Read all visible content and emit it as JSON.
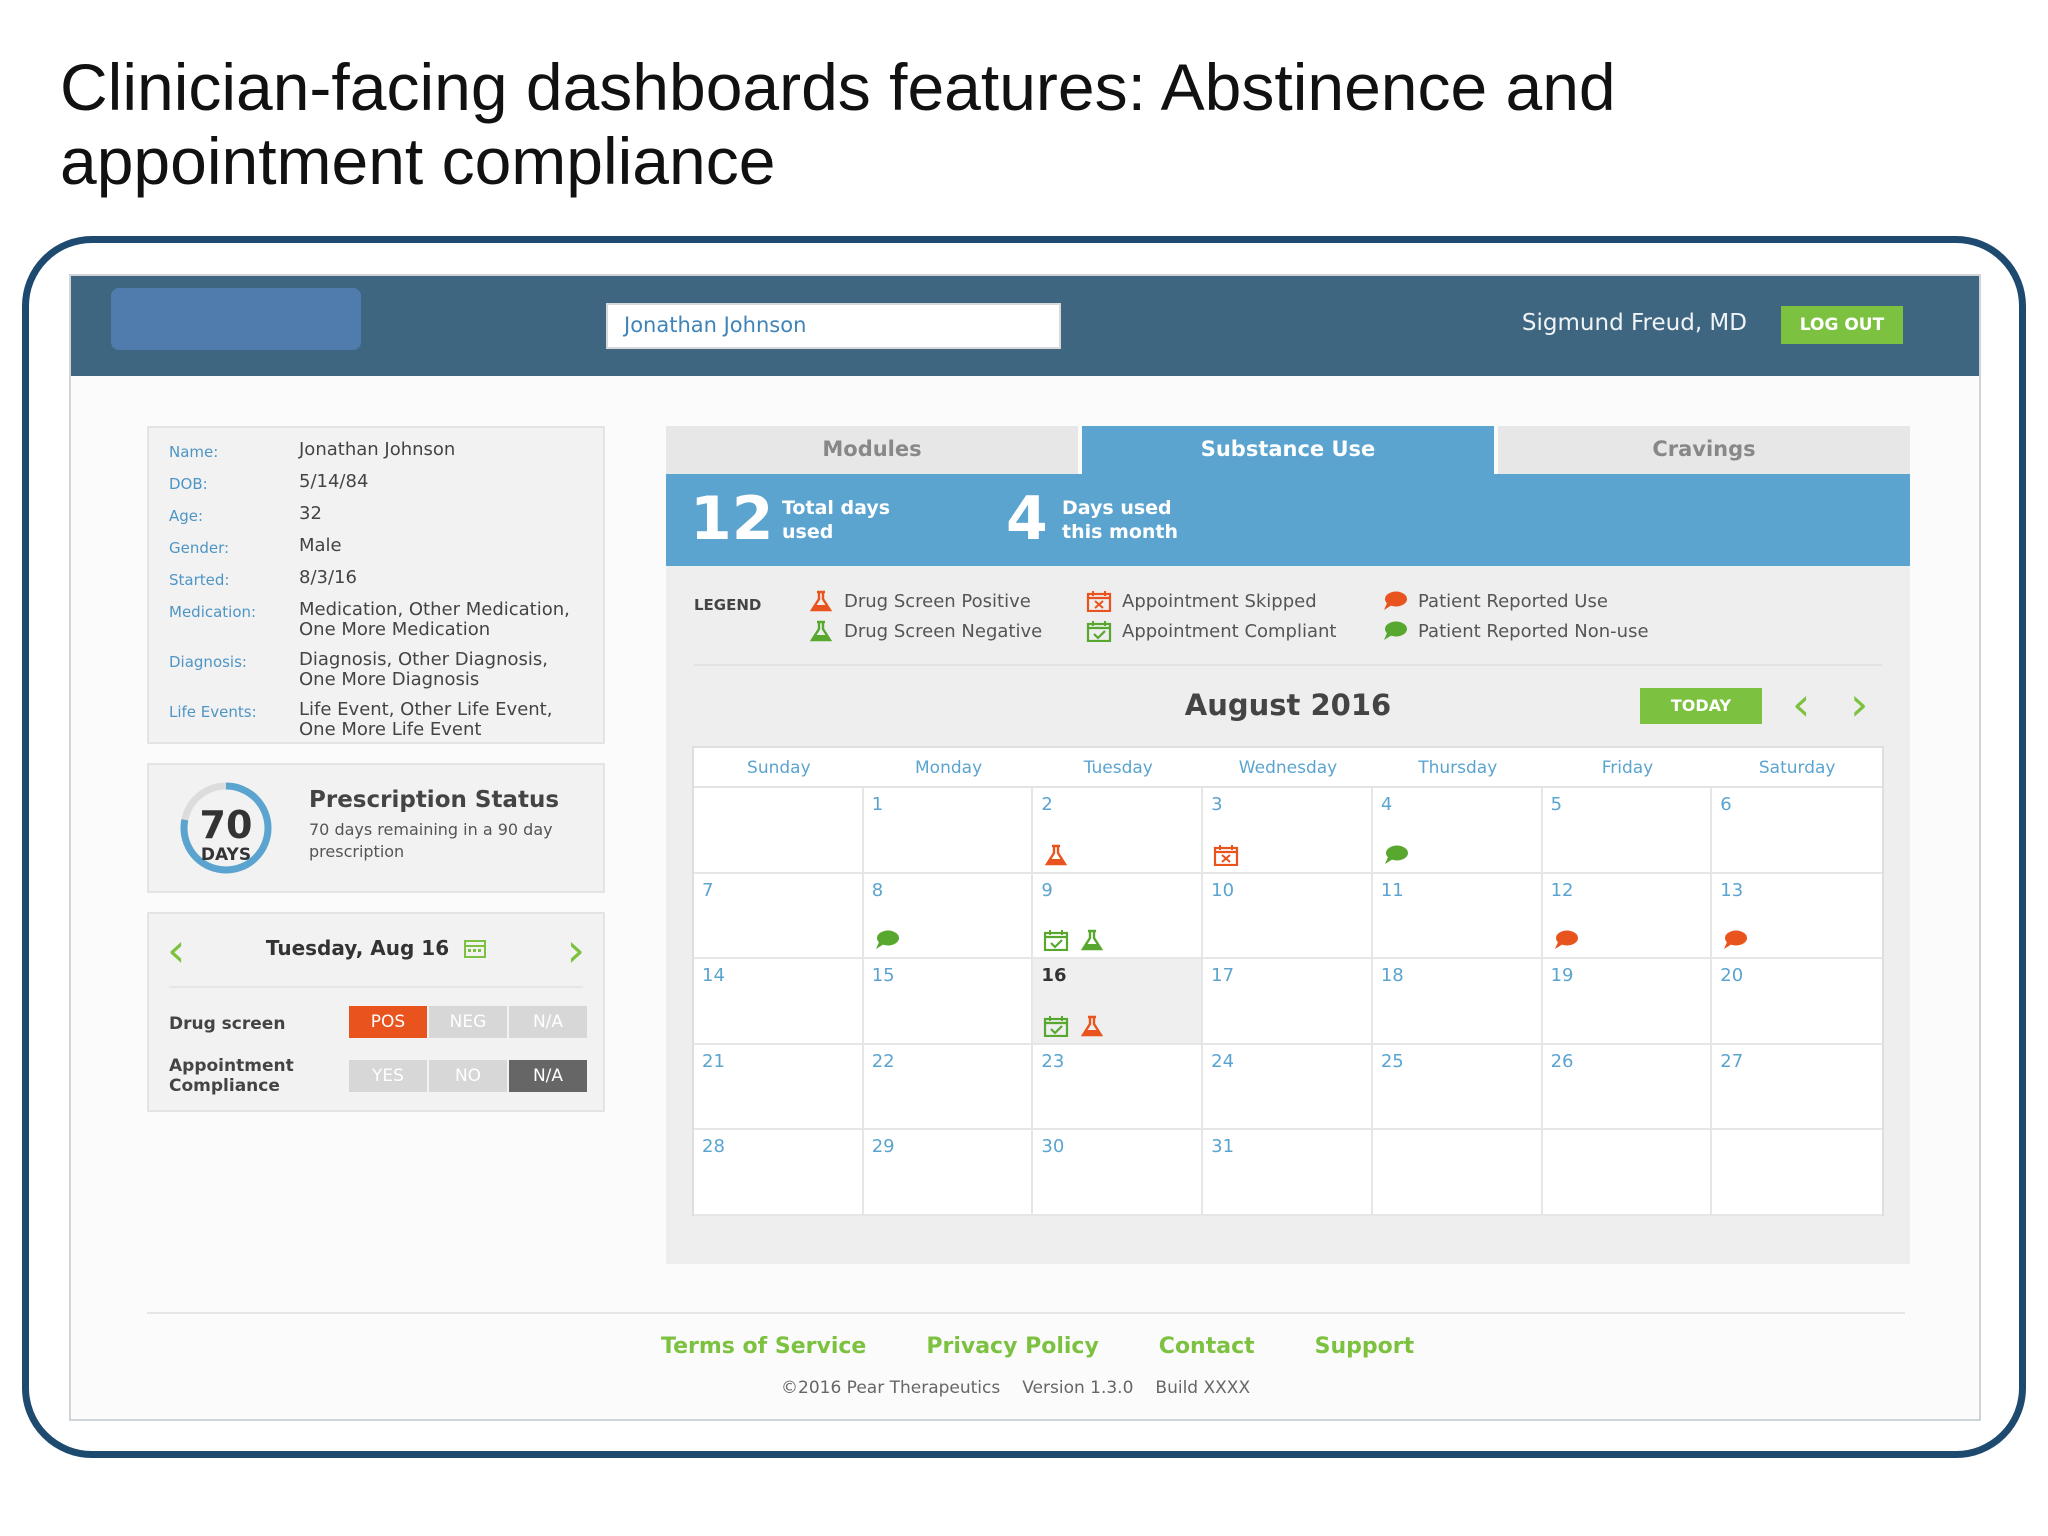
{
  "slide": {
    "title": "Clinician-facing dashboards features: Abstinence and appointment compliance"
  },
  "header": {
    "search_value": "Jonathan Johnson",
    "doctor": "Sigmund Freud, MD",
    "logout": "LOG OUT"
  },
  "patient": {
    "name_label": "Name:",
    "name": "Jonathan Johnson",
    "dob_label": "DOB:",
    "dob": "5/14/84",
    "age_label": "Age:",
    "age": "32",
    "gender_label": "Gender:",
    "gender": "Male",
    "started_label": "Started:",
    "started": "8/3/16",
    "medication_label": "Medication:",
    "medication": "Medication, Other Medication, One More Medication",
    "diagnosis_label": "Diagnosis:",
    "diagnosis": "Diagnosis, Other Diagnosis, One More Diagnosis",
    "life_events_label": "Life Events:",
    "life_events": "Life Event, Other Life Event, One More Life Event"
  },
  "prescription": {
    "days": "70",
    "days_unit": "DAYS",
    "remaining_fraction": 0.78,
    "title": "Prescription Status",
    "desc": "70 days remaining in a 90 day prescription"
  },
  "daily": {
    "date": "Tuesday, Aug 16",
    "drug_screen_label": "Drug screen",
    "drug_screen": {
      "pos": "POS",
      "neg": "NEG",
      "na": "N/A",
      "selected": "POS"
    },
    "appt_label_line1": "Appointment",
    "appt_label_line2": "Compliance",
    "appointment": {
      "yes": "YES",
      "no": "NO",
      "na": "N/A",
      "selected": "N/A"
    }
  },
  "tabs": [
    {
      "label": "Modules",
      "active": false
    },
    {
      "label": "Substance Use",
      "active": true
    },
    {
      "label": "Cravings",
      "active": false
    }
  ],
  "stats": {
    "total_days": "12",
    "total_days_label1": "Total days",
    "total_days_label2": "used",
    "month_days": "4",
    "month_days_label1": "Days used",
    "month_days_label2": "this month"
  },
  "legend": {
    "heading": "LEGEND",
    "drug_pos": "Drug Screen Positive",
    "drug_neg": "Drug Screen Negative",
    "appt_skipped": "Appointment Skipped",
    "appt_compliant": "Appointment Compliant",
    "reported_use": "Patient Reported Use",
    "reported_nonuse": "Patient Reported Non-use"
  },
  "calendar": {
    "month": "August 2016",
    "today": "TODAY",
    "weekdays": [
      "Sunday",
      "Monday",
      "Tuesday",
      "Wednesday",
      "Thursday",
      "Friday",
      "Saturday"
    ],
    "selected_day": "16",
    "cells": [
      {
        "day": "",
        "icons": []
      },
      {
        "day": "1",
        "icons": []
      },
      {
        "day": "2",
        "icons": [
          "flask-red"
        ]
      },
      {
        "day": "3",
        "icons": [
          "calendar-red"
        ]
      },
      {
        "day": "4",
        "icons": [
          "bubble-green"
        ]
      },
      {
        "day": "5",
        "icons": []
      },
      {
        "day": "6",
        "icons": []
      },
      {
        "day": "7",
        "icons": []
      },
      {
        "day": "8",
        "icons": [
          "bubble-green"
        ]
      },
      {
        "day": "9",
        "icons": [
          "calendar-green",
          "flask-green"
        ]
      },
      {
        "day": "10",
        "icons": []
      },
      {
        "day": "11",
        "icons": []
      },
      {
        "day": "12",
        "icons": [
          "bubble-red"
        ]
      },
      {
        "day": "13",
        "icons": [
          "bubble-red"
        ]
      },
      {
        "day": "14",
        "icons": []
      },
      {
        "day": "15",
        "icons": []
      },
      {
        "day": "16",
        "icons": [
          "calendar-green",
          "flask-red"
        ]
      },
      {
        "day": "17",
        "icons": []
      },
      {
        "day": "18",
        "icons": []
      },
      {
        "day": "19",
        "icons": []
      },
      {
        "day": "20",
        "icons": []
      },
      {
        "day": "21",
        "icons": []
      },
      {
        "day": "22",
        "icons": []
      },
      {
        "day": "23",
        "icons": []
      },
      {
        "day": "24",
        "icons": []
      },
      {
        "day": "25",
        "icons": []
      },
      {
        "day": "26",
        "icons": []
      },
      {
        "day": "27",
        "icons": []
      },
      {
        "day": "28",
        "icons": []
      },
      {
        "day": "29",
        "icons": []
      },
      {
        "day": "30",
        "icons": []
      },
      {
        "day": "31",
        "icons": []
      },
      {
        "day": "",
        "icons": []
      },
      {
        "day": "",
        "icons": []
      },
      {
        "day": "",
        "icons": []
      }
    ]
  },
  "footer": {
    "terms": "Terms of Service",
    "privacy": "Privacy Policy",
    "contact": "Contact",
    "support": "Support",
    "copyright": "©2016 Pear Therapeutics",
    "version": "Version 1.3.0",
    "build": "Build XXXX"
  },
  "colors": {
    "header": "#3e6680",
    "accent_blue": "#5ba4cf",
    "accent_green": "#7cc240",
    "alert_red": "#e8531e"
  }
}
